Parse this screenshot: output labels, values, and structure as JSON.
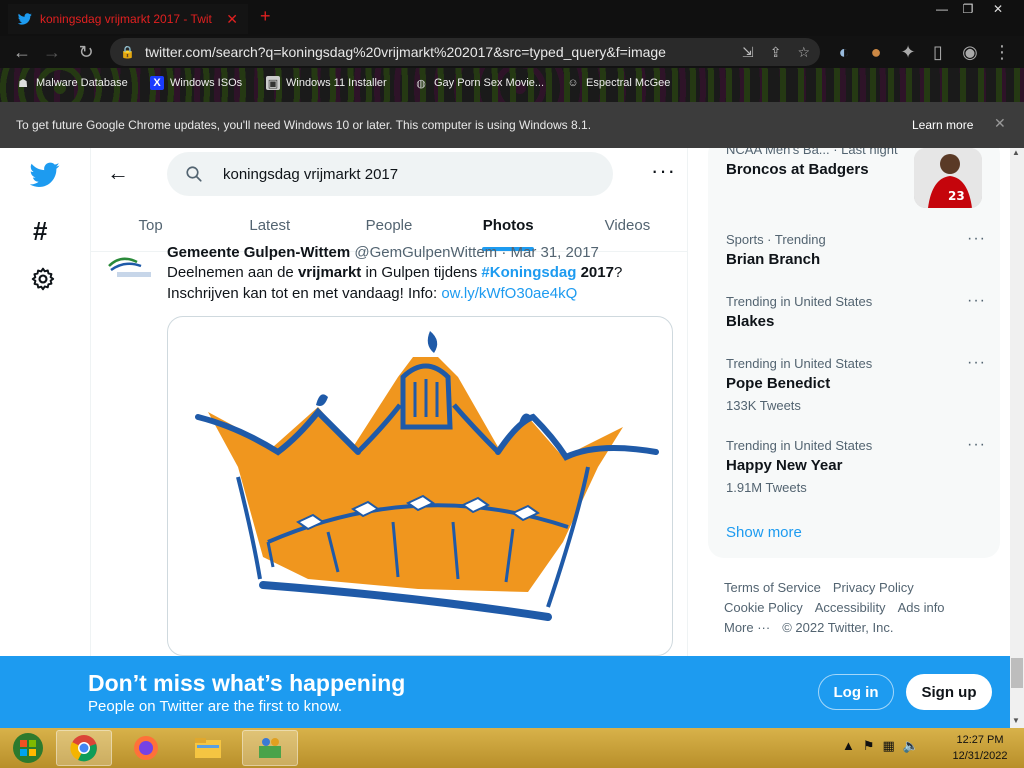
{
  "browser": {
    "tab_title": "koningsdag vrijmarkt 2017 - Twit",
    "new_tab": "+",
    "url": "twitter.com/search?q=koningsdag%20vrijmarkt%202017&src=typed_query&f=image",
    "bookmarks": [
      {
        "label": "Malware Database"
      },
      {
        "label": "Windows ISOs"
      },
      {
        "label": "Windows 11 Installer"
      },
      {
        "label": "Gay Porn Sex Movie..."
      },
      {
        "label": "Espectral McGee"
      }
    ],
    "infobar": {
      "message": "To get future Google Chrome updates, you'll need Windows 10 or later. This computer is using Windows 8.1.",
      "learn_more": "Learn more"
    }
  },
  "search": {
    "query": "koningsdag vrijmarkt 2017"
  },
  "tabs": [
    {
      "label": "Top"
    },
    {
      "label": "Latest"
    },
    {
      "label": "People"
    },
    {
      "label": "Photos"
    },
    {
      "label": "Videos"
    }
  ],
  "tweet": {
    "author": "Gemeente Gulpen-Wittem",
    "handle": "@GemGulpenWittem · Mar 31, 2017",
    "text_part1": "Deelnemen aan de ",
    "text_bold1": "vrijmarkt",
    "text_part2": " in Gulpen tijdens ",
    "hashtag": "#Koningsdag",
    "text_part3": " ",
    "text_bold2": "2017",
    "text_part4": "?",
    "line2": "Inschrijven kan tot en met vandaag! Info: ",
    "link": "ow.ly/kWfO30ae4kQ"
  },
  "trends": [
    {
      "meta": "NCAA Men's Ba... · Last night",
      "name": "Broncos at Badgers",
      "count": ""
    },
    {
      "meta": "Sports · Trending",
      "name": "Brian Branch",
      "count": ""
    },
    {
      "meta": "Trending in United States",
      "name": "Blakes",
      "count": ""
    },
    {
      "meta": "Trending in United States",
      "name": "Pope Benedict",
      "count": "133K Tweets"
    },
    {
      "meta": "Trending in United States",
      "name": "Happy New Year",
      "count": "1.91M Tweets"
    }
  ],
  "show_more": "Show more",
  "footer": {
    "terms": "Terms of Service",
    "privacy": "Privacy Policy",
    "cookie": "Cookie Policy",
    "accessibility": "Accessibility",
    "ads": "Ads info",
    "more": "More ···",
    "copyright": "© 2022 Twitter, Inc."
  },
  "banner": {
    "title": "Don’t miss what’s happening",
    "subtitle": "People on Twitter are the first to know.",
    "login": "Log in",
    "signup": "Sign up"
  },
  "taskbar": {
    "time": "12:27 PM",
    "date": "12/31/2022"
  },
  "colors": {
    "twitter_blue": "#1d9bf0",
    "crown_orange": "#f0961e",
    "crown_blue": "#1f5aa8"
  }
}
